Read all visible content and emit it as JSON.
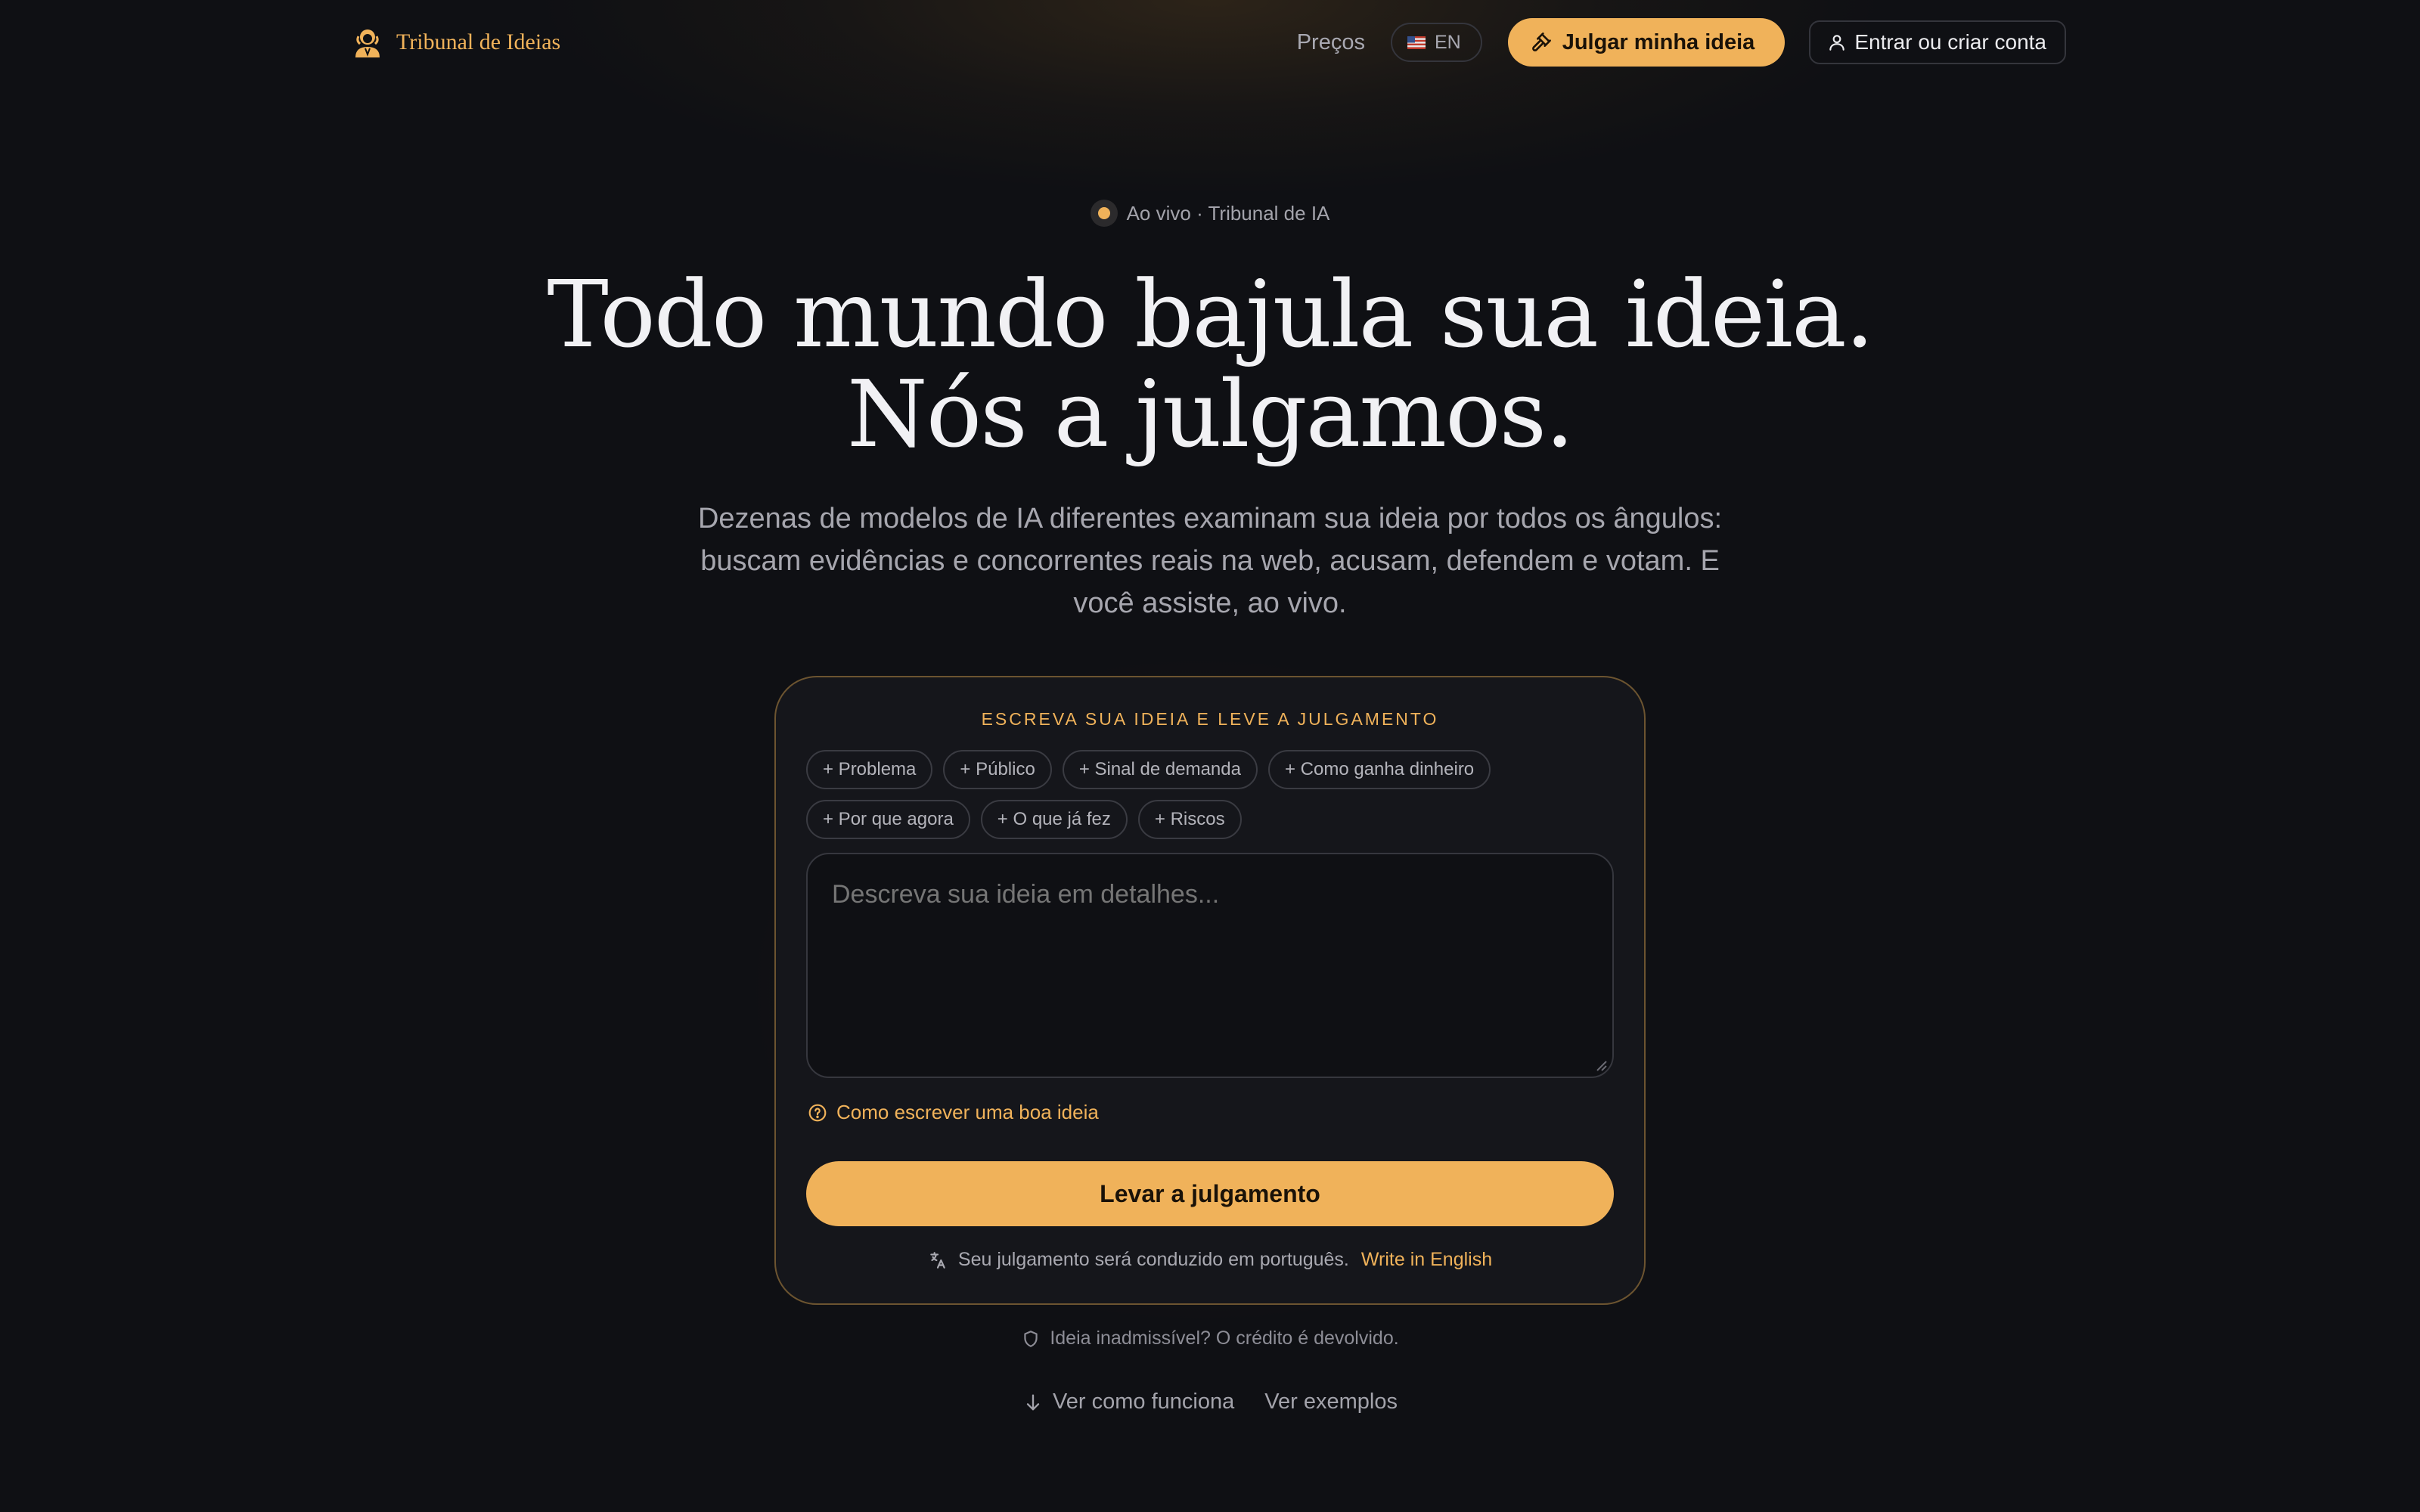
{
  "brand": {
    "name": "Tribunal de Ideias",
    "accent": "#f0b25a"
  },
  "nav": {
    "pricing": "Preços",
    "lang": "EN",
    "judge_button": "Julgar minha ideia",
    "login_button": "Entrar ou criar conta"
  },
  "hero": {
    "live_badge": "Ao vivo · Tribunal de IA",
    "headline_line1": "Todo mundo bajula sua ideia.",
    "headline_line2": "Nós a julgamos.",
    "subtitle": "Dezenas de modelos de IA diferentes examinam sua ideia por todos os ângulos: buscam evidências e concorrentes reais na web, acusam, defendem e votam. E você assiste, ao vivo."
  },
  "card": {
    "label": "ESCREVA SUA IDEIA E LEVE A JULGAMENTO",
    "chips_row1": [
      "+ Problema",
      "+ Público",
      "+ Sinal de demanda",
      "+ Como ganha dinheiro"
    ],
    "chips_row2": [
      "+ Por que agora",
      "+ O que já fez",
      "+ Riscos"
    ],
    "placeholder": "Descreva sua ideia em detalhes...",
    "help_link": "Como escrever uma boa ideia",
    "submit": "Levar a julgamento",
    "lang_note": "Seu julgamento será conduzido em português.",
    "lang_switch": "Write in English"
  },
  "footer": {
    "refund": "Ideia inadmissível? O crédito é devolvido.",
    "how_it_works": "Ver como funciona",
    "examples": "Ver exemplos"
  },
  "icons": {
    "brand": "judge-avatar-icon",
    "flag": "us-flag-icon",
    "gavel": "gavel-icon",
    "user": "user-icon",
    "help": "question-circle-icon",
    "translate": "translate-icon",
    "shield": "shield-icon",
    "arrow": "arrow-down-icon"
  }
}
